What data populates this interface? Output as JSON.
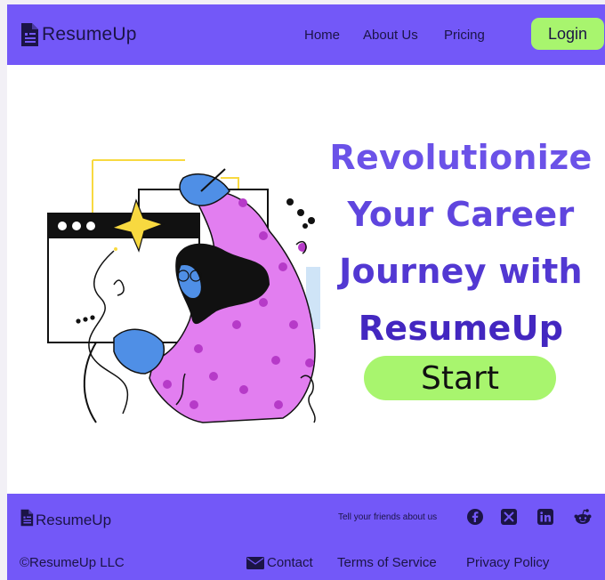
{
  "colors": {
    "brand_purple": "#7358f8",
    "accent_green": "#a8f56e",
    "headline_purple": "#5a3fd8",
    "illustration_pink": "#e27ef0",
    "illustration_blue": "#4f8fe6",
    "illustration_yellow": "#f8d940"
  },
  "header": {
    "brand": {
      "name": "ResumeUp",
      "icon": "document-icon"
    },
    "nav": [
      {
        "label": "Home"
      },
      {
        "label": "About Us"
      },
      {
        "label": "Pricing"
      }
    ],
    "login_label": "Login"
  },
  "hero": {
    "headline_lines": [
      "Revolutionize",
      "Your Career",
      "Journey with",
      "ResumeUp"
    ],
    "start_label": "Start",
    "illustration": "woman-working-at-computer-illustration"
  },
  "footer": {
    "brand": {
      "name": "ResumeUp",
      "icon": "document-icon"
    },
    "share_text": "Tell your friends about us",
    "social": [
      {
        "name": "facebook-icon"
      },
      {
        "name": "x-icon"
      },
      {
        "name": "linkedin-icon"
      },
      {
        "name": "reddit-icon"
      }
    ],
    "copyright": "©ResumeUp LLC",
    "links": [
      {
        "label": "Contact",
        "icon": "mail-icon"
      },
      {
        "label": "Terms of Service"
      },
      {
        "label": "Privacy Policy"
      }
    ]
  }
}
